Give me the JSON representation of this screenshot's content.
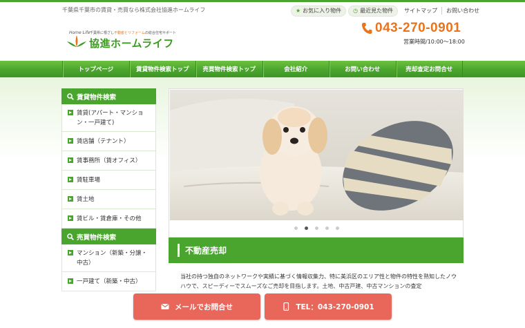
{
  "header": {
    "tagline": "千葉県千葉市の賃貸・売買なら株式会社協進ホームライフ",
    "favorites_label": "お気に入り物件",
    "recent_label": "最近見た物件",
    "sitemap_label": "サイトマップ",
    "contact_label": "お問い合わせ",
    "phone_number": "043-270-0901",
    "hours": "営業時間/10:00～18:00"
  },
  "logo": {
    "brand_en": "Home Life",
    "sub_prefix": "千葉県に根ざし",
    "sub_highlight": "不動産とリフォーム",
    "sub_suffix": "の総合住宅サポート",
    "name": "協進ホームライフ"
  },
  "nav": {
    "items": [
      "トップページ",
      "賃貸物件検索トップ",
      "売買物件検索トップ",
      "会社紹介",
      "お問い合わせ",
      "売却査定お問合せ"
    ]
  },
  "sidebar": {
    "rental_heading": "賃貸物件検索",
    "rental_items": [
      "賃貸(アパート・マンション・一戸建て)",
      "賃店舗（テナント）",
      "賃事務所（賃オフィス）",
      "賃駐車場",
      "賃土地",
      "賃ビル・賃倉庫・その他"
    ],
    "sale_heading": "売買物件検索",
    "sale_items": [
      "マンション（新築・分譲・中古）",
      "一戸建て（新築・中古）"
    ]
  },
  "slider": {
    "slide_count": 5,
    "active_index": 1
  },
  "section": {
    "title": "不動産売却",
    "body": "当社の持つ独自のネットワークや実績に基づく情報収集力、特に美浜区のエリア性と物件の特性を熟知したノウハウで、スピーディーでスムーズなご売却を目指します。土地、中古戸建、中古マンションの査定"
  },
  "cta": {
    "mail_label": "メールでお問合せ",
    "tel_label": "TEL：043-270-0901"
  },
  "colors": {
    "brand_green": "#4aa52e",
    "accent_orange": "#e8741d",
    "cta_red": "#e9665a"
  }
}
